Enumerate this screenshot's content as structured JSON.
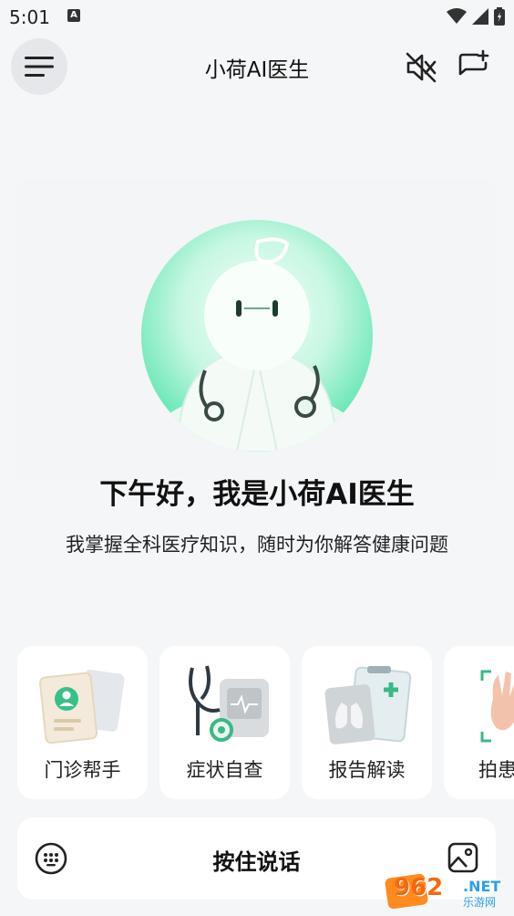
{
  "status_bar": {
    "time": "5:01",
    "notification_glyph": "A"
  },
  "header": {
    "title": "小荷AI医生"
  },
  "hero": {
    "greeting": "下午好，我是小荷AI医生",
    "subtitle": "我掌握全科医疗知识，随时为你解答健康问题"
  },
  "features": [
    {
      "label": "门诊帮手",
      "icon": "clinic-card-icon"
    },
    {
      "label": "症状自查",
      "icon": "stethoscope-monitor-icon"
    },
    {
      "label": "报告解读",
      "icon": "lung-report-icon"
    },
    {
      "label": "拍患",
      "icon": "hand-scan-icon"
    }
  ],
  "input_bar": {
    "talk_label": "按住说话"
  },
  "watermark": {
    "number": "962",
    "net": ".NET",
    "sub": "乐游网"
  },
  "colors": {
    "accent_green": "#4adfa6",
    "background": "#f5f6f8"
  }
}
